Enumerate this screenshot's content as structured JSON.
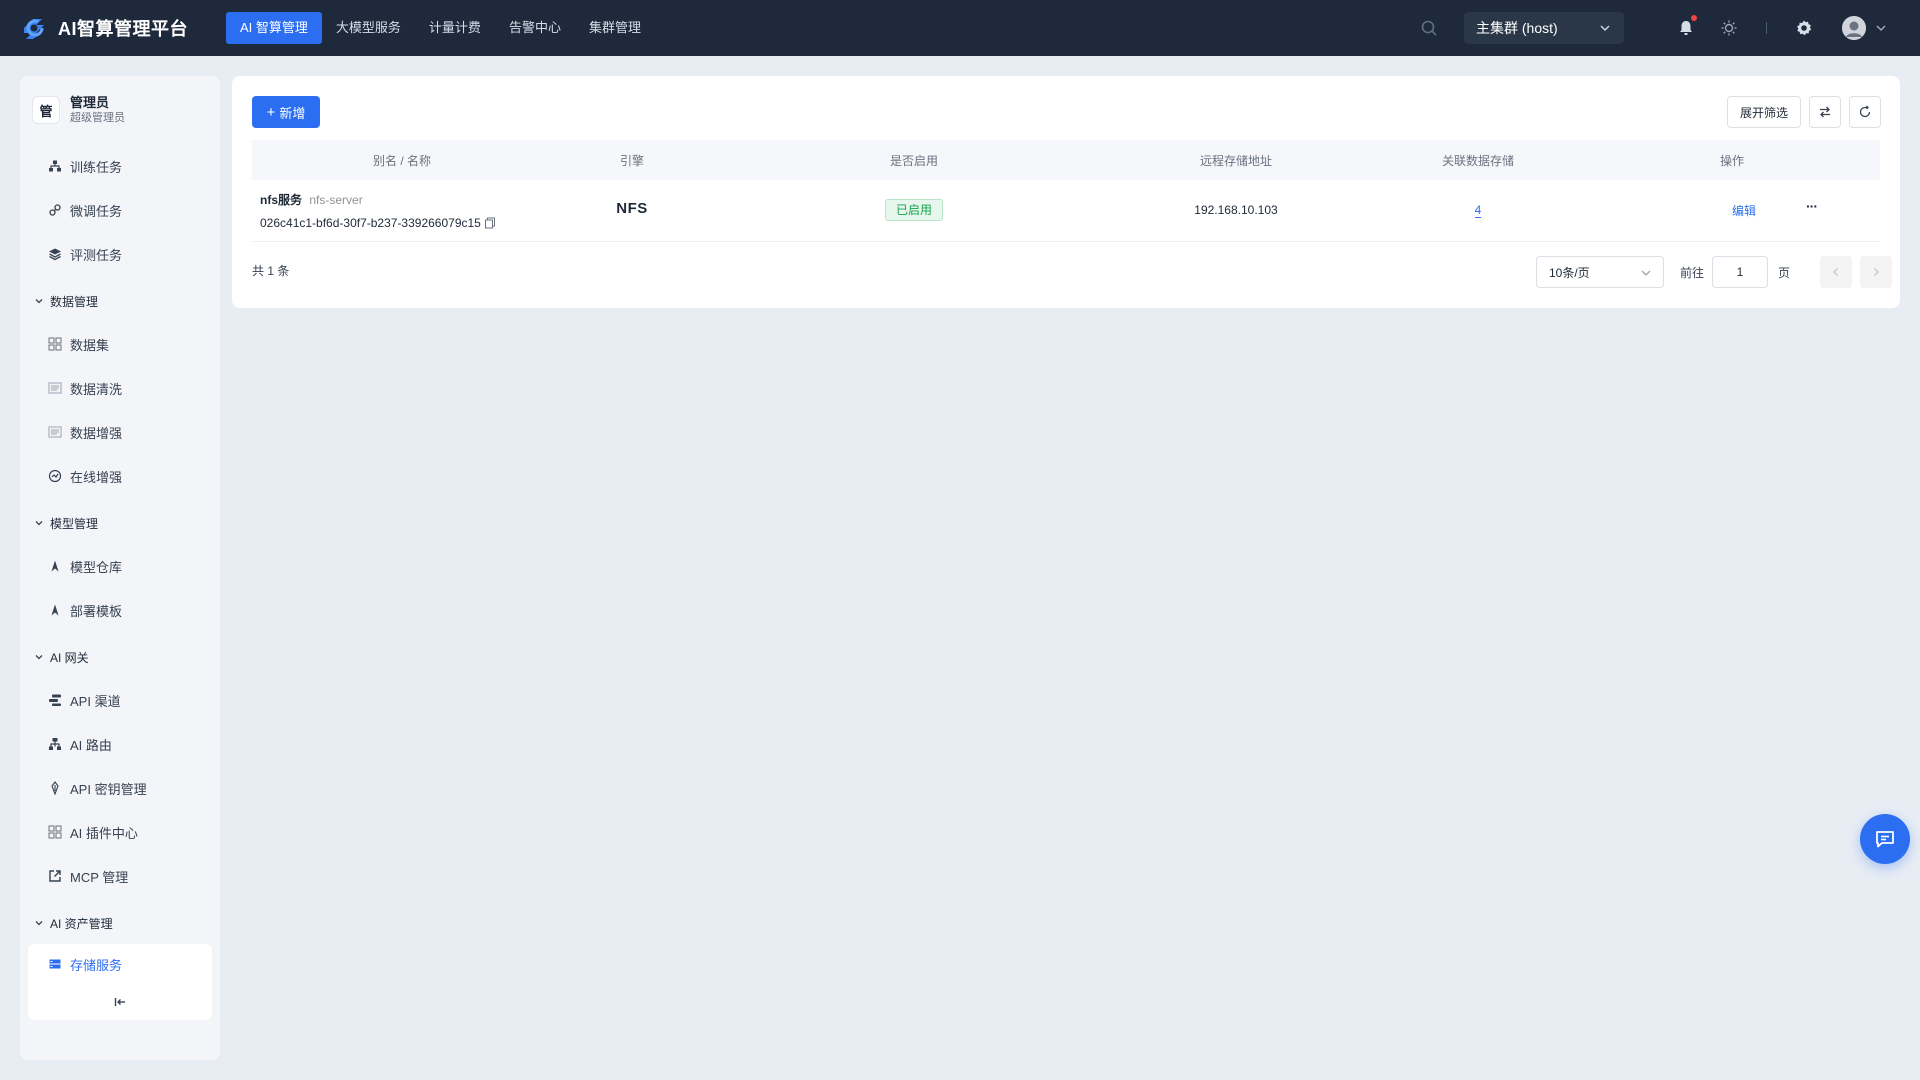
{
  "brand": {
    "name": "AI智算管理平台"
  },
  "nav": {
    "items": [
      {
        "label": "AI 智算管理",
        "active": true
      },
      {
        "label": "大模型服务",
        "active": false
      },
      {
        "label": "计量计费",
        "active": false
      },
      {
        "label": "告警中心",
        "active": false
      },
      {
        "label": "集群管理",
        "active": false
      }
    ]
  },
  "topbar": {
    "cluster": "主集群 (host)",
    "icons": [
      "search-icon",
      "bell-icon",
      "sun-icon",
      "gear-icon",
      "avatar",
      "chevron-down-icon"
    ]
  },
  "user": {
    "avatar_text": "管",
    "name": "管理员",
    "role": "超级管理员"
  },
  "sidebar": {
    "top_items": [
      {
        "label": "训练任务",
        "icon": "sitemap-icon"
      },
      {
        "label": "微调任务",
        "icon": "link-icon"
      },
      {
        "label": "评测任务",
        "icon": "layers-icon"
      }
    ],
    "groups": [
      {
        "title": "数据管理",
        "items": [
          {
            "label": "数据集",
            "icon": "grid-icon"
          },
          {
            "label": "数据清洗",
            "icon": "list-icon"
          },
          {
            "label": "数据增强",
            "icon": "list-icon"
          },
          {
            "label": "在线增强",
            "icon": "gauge-icon"
          }
        ]
      },
      {
        "title": "模型管理",
        "items": [
          {
            "label": "模型仓库",
            "icon": "compass-icon"
          },
          {
            "label": "部署模板",
            "icon": "compass-icon"
          }
        ]
      },
      {
        "title": "AI 网关",
        "items": [
          {
            "label": "API 渠道",
            "icon": "channel-icon"
          },
          {
            "label": "AI 路由",
            "icon": "route-icon"
          },
          {
            "label": "API 密钥管理",
            "icon": "key-icon"
          },
          {
            "label": "AI 插件中心",
            "icon": "grid-icon"
          },
          {
            "label": "MCP 管理",
            "icon": "external-link-icon"
          }
        ]
      },
      {
        "title": "AI 资产管理",
        "items": [
          {
            "label": "存储服务",
            "icon": "storage-icon",
            "active": true
          }
        ]
      }
    ]
  },
  "toolbar": {
    "add_label": "新增",
    "filter_label": "展开筛选"
  },
  "table": {
    "columns": [
      "别名 / 名称",
      "引擎",
      "是否启用",
      "远程存储地址",
      "关联数据存储",
      "操作"
    ],
    "rows": [
      {
        "alias": "nfs服务",
        "name": "nfs-server",
        "uuid": "026c41c1-bf6d-30f7-b237-339266079c15",
        "engine": "NFS",
        "status": "已启用",
        "address": "192.168.10.103",
        "linked": "4",
        "edit": "编辑",
        "more": "···"
      }
    ]
  },
  "pagination": {
    "total": "共 1 条",
    "page_size": "10条/页",
    "goto_label": "前往",
    "current_page": "1",
    "page_label": "页"
  },
  "colors": {
    "primary": "#2b6ef2",
    "topbar_bg": "#1e2a3b",
    "success": "#16a34a",
    "alert_dot": "#ef4444"
  }
}
